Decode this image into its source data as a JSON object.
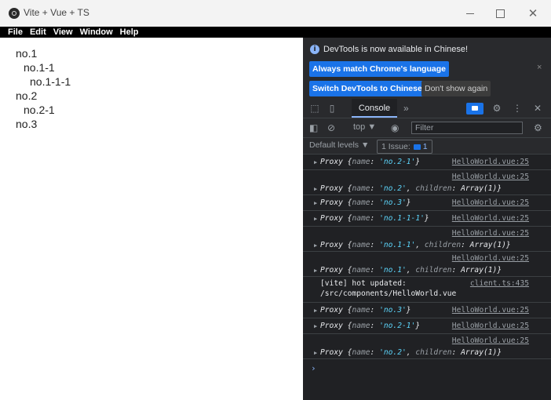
{
  "window": {
    "title": "Vite + Vue + TS"
  },
  "menu": [
    "File",
    "Edit",
    "View",
    "Window",
    "Help"
  ],
  "page": {
    "tree": [
      {
        "label": "no.1",
        "level": 0
      },
      {
        "label": "no.1-1",
        "level": 1
      },
      {
        "label": "no.1-1-1",
        "level": 2
      },
      {
        "label": "no.2",
        "level": 0
      },
      {
        "label": "no.2-1",
        "level": 1
      },
      {
        "label": "no.3",
        "level": 0
      }
    ]
  },
  "devtools": {
    "notice": {
      "text": "DevTools is now available in Chinese!",
      "always_match": "Always match Chrome's language",
      "switch": "Switch DevTools to Chinese",
      "dont_show": "Don't show again",
      "close": "×"
    },
    "tabs": {
      "console": "Console",
      "more": "»"
    },
    "toolbar": {
      "context": "top ▼",
      "filter_placeholder": "Filter"
    },
    "levels": {
      "default_levels": "Default levels ▼",
      "issues_label": "1 Issue:",
      "issues_count": "1"
    },
    "console": [
      {
        "kind": "single",
        "src": "HelloWorld.vue:25",
        "prefix": "Proxy {",
        "k1": "name",
        "v1": "'no.2-1'",
        "k2": "",
        "v2": "",
        "suffix": "}"
      },
      {
        "kind": "double",
        "src": "HelloWorld.vue:25",
        "prefix": "Proxy {",
        "k1": "name",
        "v1": "'no.2'",
        "k2": "children",
        "v2": "Array(1)",
        "suffix": "}"
      },
      {
        "kind": "single",
        "src": "HelloWorld.vue:25",
        "prefix": "Proxy {",
        "k1": "name",
        "v1": "'no.3'",
        "k2": "",
        "v2": "",
        "suffix": "}"
      },
      {
        "kind": "single",
        "src": "HelloWorld.vue:25",
        "prefix": "Proxy {",
        "k1": "name",
        "v1": "'no.1-1-1'",
        "k2": "",
        "v2": "",
        "suffix": "}"
      },
      {
        "kind": "double",
        "src": "HelloWorld.vue:25",
        "prefix": "Proxy {",
        "k1": "name",
        "v1": "'no.1-1'",
        "k2": "children",
        "v2": "Array(1)",
        "suffix": "}"
      },
      {
        "kind": "double",
        "src": "HelloWorld.vue:25",
        "prefix": "Proxy {",
        "k1": "name",
        "v1": "'no.1'",
        "k2": "children",
        "v2": "Array(1)",
        "suffix": "}"
      },
      {
        "kind": "vite",
        "src": "client.ts:435",
        "line1": "[vite] hot updated:",
        "line2": "/src/components/HelloWorld.vue"
      },
      {
        "kind": "single",
        "src": "HelloWorld.vue:25",
        "prefix": "Proxy {",
        "k1": "name",
        "v1": "'no.3'",
        "k2": "",
        "v2": "",
        "suffix": "}"
      },
      {
        "kind": "single",
        "src": "HelloWorld.vue:25",
        "prefix": "Proxy {",
        "k1": "name",
        "v1": "'no.2-1'",
        "k2": "",
        "v2": "",
        "suffix": "}"
      },
      {
        "kind": "double",
        "src": "HelloWorld.vue:25",
        "prefix": "Proxy {",
        "k1": "name",
        "v1": "'no.2'",
        "k2": "children",
        "v2": "Array(1)",
        "suffix": "}"
      }
    ],
    "prompt": "›"
  }
}
